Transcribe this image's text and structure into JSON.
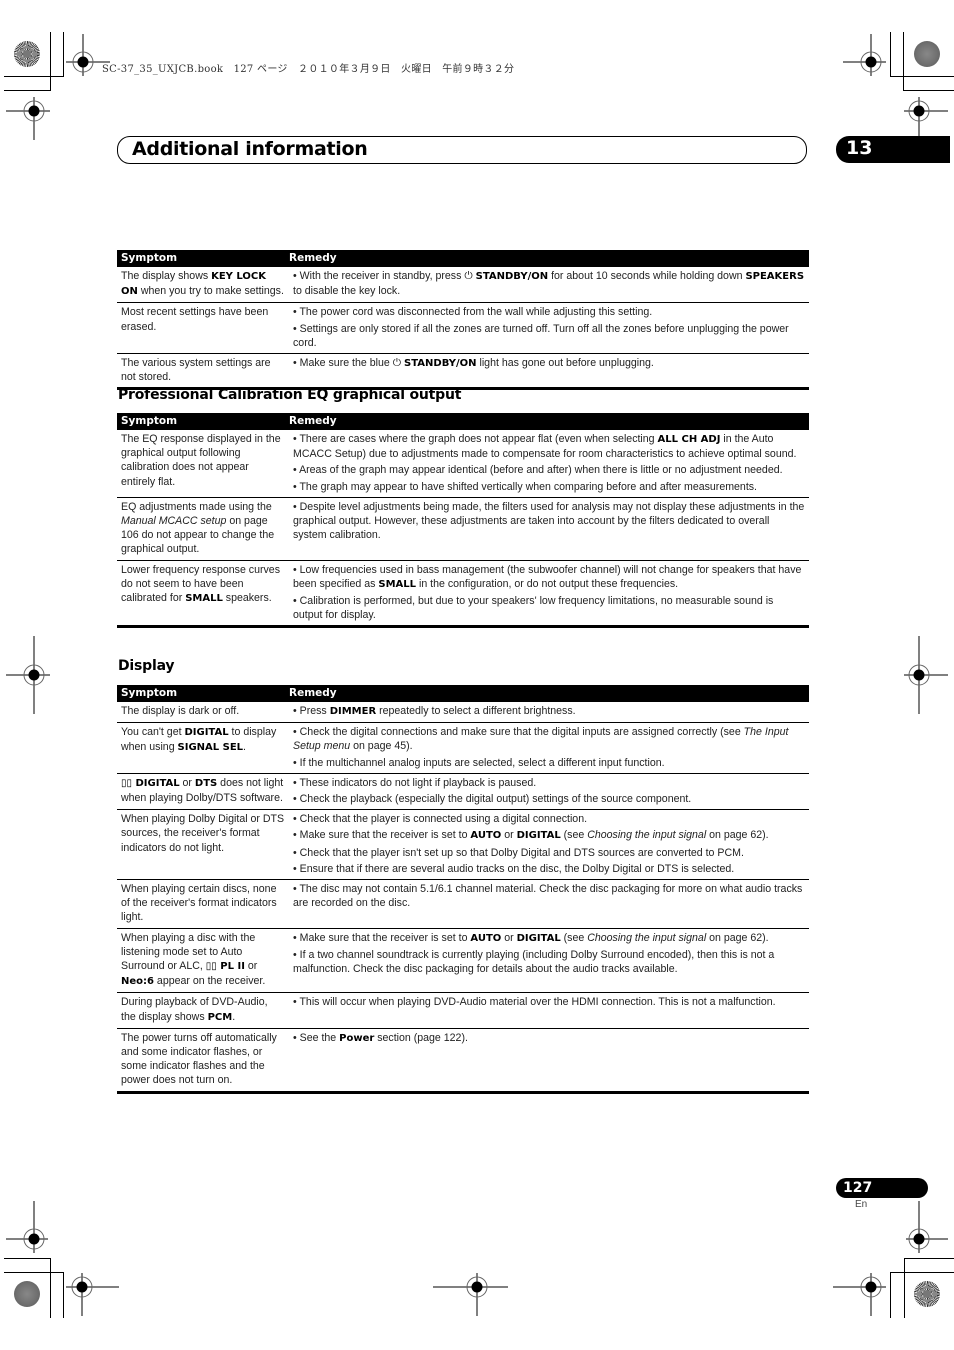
{
  "print_header": "SC-37_35_UXJCB.book　127 ページ　２０１０年３月９日　火曜日　午前９時３２分",
  "chapter": {
    "title": "Additional information",
    "number": "13"
  },
  "page": {
    "number": "127",
    "language": "En"
  },
  "icons": {
    "standby": "⏻",
    "dolby": "▯▯"
  },
  "table_headers": {
    "symptom": "Symptom",
    "remedy": "Remedy"
  },
  "sections": [
    {
      "title": "",
      "rows": [
        {
          "symptom": "The display shows <b>KEY LOCK ON</b> when you try to make settings.",
          "remedies": [
            "• With the receiver in standby, press ⏻ <b>STANDBY/ON</b> for about 10 seconds while holding down <b>SPEAKERS</b> to disable the key lock."
          ]
        },
        {
          "symptom": "Most recent settings have been erased.",
          "remedies": [
            "• The power cord was disconnected from the wall while adjusting this setting.",
            "• Settings are only stored if all the zones are turned off. Turn off all the zones before unplugging the power cord."
          ]
        },
        {
          "symptom": "The various system settings are not stored.",
          "remedies": [
            "• Make sure the blue ⏻ <b>STANDBY/ON</b> light has gone out before unplugging."
          ]
        }
      ]
    },
    {
      "title": "Professional Calibration EQ graphical output",
      "rows": [
        {
          "symptom": "The EQ response displayed in the graphical output following calibration does not appear entirely flat.",
          "remedies": [
            "• There are cases where the graph does not appear flat (even when selecting <b>ALL CH ADJ</b> in the Auto MCACC Setup) due to adjustments made to compensate for room characteristics to achieve optimal sound.",
            "• Areas of the graph may appear identical (before and after) when there is little or no adjustment needed.",
            "• The graph may appear to have shifted vertically when comparing before and after measurements."
          ]
        },
        {
          "symptom": "EQ adjustments made using the <i>Manual MCACC setup</i> on page 106 do not appear to change the graphical output.",
          "remedies": [
            "• Despite level adjustments being made, the filters used for analysis may not display these adjustments in the graphical output. However, these adjustments are taken into account by the filters dedicated to overall system calibration."
          ]
        },
        {
          "symptom": "Lower frequency response curves do not seem to have been calibrated for <b>SMALL</b> speakers.",
          "remedies": [
            "• Low frequencies used in bass management (the subwoofer channel) will not change for speakers that have been specified as <b>SMALL</b> in the configuration, or do not output these frequencies.",
            "• Calibration is performed, but due to your speakers' low frequency limitations, no measurable sound is output for display."
          ]
        }
      ]
    },
    {
      "title": "Display",
      "rows": [
        {
          "symptom": "The display is dark or off.",
          "remedies": [
            "• Press <b>DIMMER</b> repeatedly to select a different brightness."
          ]
        },
        {
          "symptom": "You can't get <b>DIGITAL</b> to display when using <b>SIGNAL SEL</b>.",
          "remedies": [
            "• Check the digital connections and make sure that the digital inputs are assigned correctly (see <i>The Input Setup menu</i> on page 45).",
            "• If the multichannel analog inputs are selected, select a different input function."
          ]
        },
        {
          "symptom": "<b>▯▯ DIGITAL</b> or <b>DTS</b> does not light when playing Dolby/DTS software.",
          "remedies": [
            "• These indicators do not light if playback is paused.",
            "• Check the playback (especially the digital output) settings of the source component."
          ]
        },
        {
          "symptom": "When playing Dolby Digital or DTS sources, the receiver's format indicators do not light.",
          "remedies": [
            "• Check that the player is connected using a digital connection.",
            "• Make sure that the receiver is set to <b>AUTO</b> or <b>DIGITAL</b> (see <i>Choosing the input signal</i> on page 62).",
            "• Check that the player isn't set up so that Dolby Digital and DTS sources are converted to PCM.",
            "• Ensure that if there are several audio tracks on the disc, the Dolby Digital or DTS is selected."
          ]
        },
        {
          "symptom": "When playing certain discs, none of the receiver's format indicators light.",
          "remedies": [
            "• The disc may not contain 5.1/6.1 channel material. Check the disc packaging for more on what audio tracks are recorded on the disc."
          ]
        },
        {
          "symptom": "When playing a disc with the listening mode set to Auto Surround or ALC, <b>▯▯ PL II</b> or <b>Neo:6</b> appear on the receiver.",
          "remedies": [
            "• Make sure that the receiver is set to <b>AUTO</b> or <b>DIGITAL</b> (see <i>Choosing the input signal</i> on page 62).",
            "• If a two channel soundtrack is currently playing (including Dolby Surround encoded), then this is not a malfunction. Check the disc packaging for details about the audio tracks available."
          ]
        },
        {
          "symptom": "During playback of DVD-Audio, the display shows <b>PCM</b>.",
          "remedies": [
            "• This will occur when playing DVD-Audio material over the HDMI connection. This is not a malfunction."
          ]
        },
        {
          "symptom": "The power turns off automatically and some indicator flashes, or some indicator flashes and the power does not turn on.",
          "remedies": [
            "• See the <b>Power</b> section (page 122)."
          ]
        }
      ]
    }
  ]
}
